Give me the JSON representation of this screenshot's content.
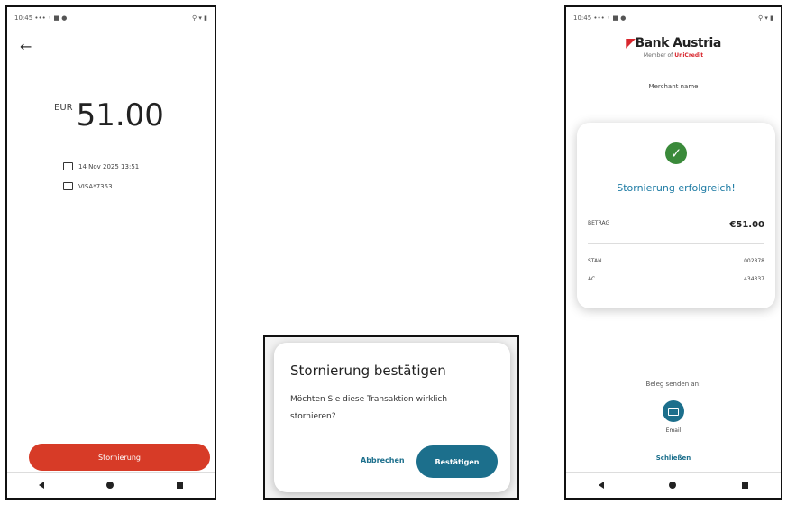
{
  "status_bar": {
    "left": "10:45 ••• ◦ ■ ●",
    "right": "⚲ ▾ ▮"
  },
  "screen1": {
    "currency": "EUR",
    "amount": "51.00",
    "date": "14 Nov 2025 13:51",
    "card": "VISA*7353",
    "cancel_button": "Stornierung"
  },
  "dialog": {
    "title": "Stornierung bestätigen",
    "text": "Möchten Sie diese Transaktion wirklich stornieren?",
    "cancel": "Abbrechen",
    "confirm": "Bestätigen"
  },
  "screen3": {
    "logo": "Bank Austria",
    "logo_sub": "Member of",
    "logo_sub_brand": "UniCredit",
    "merchant": "Merchant name",
    "success_title": "Stornierung erfolgreich!",
    "amount_label": "BETRAG",
    "amount_value": "€51.00",
    "stan_label": "STAN",
    "stan_value": "002878",
    "ac_label": "AC",
    "ac_value": "434337",
    "receipt_label": "Beleg senden an:",
    "email_label": "Email",
    "close": "Schließen"
  },
  "colors": {
    "red": "#d73b27",
    "teal": "#1c6f8c",
    "green": "#3a8a3a"
  }
}
